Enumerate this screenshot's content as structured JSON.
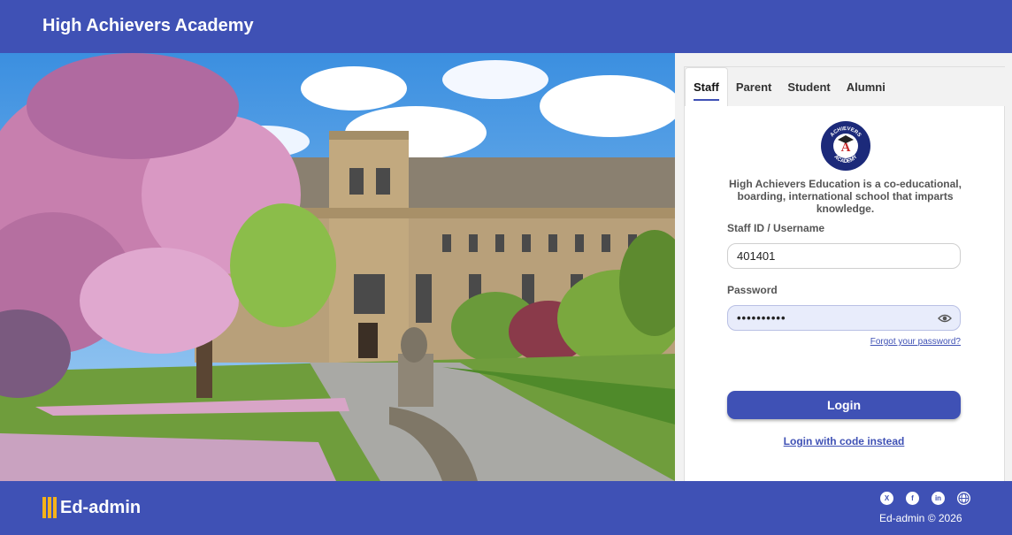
{
  "header": {
    "title": "High Achievers Academy"
  },
  "hero": {
    "image": "campus-photo"
  },
  "tabs": [
    {
      "label": "Staff",
      "active": true
    },
    {
      "label": "Parent",
      "active": false
    },
    {
      "label": "Student",
      "active": false
    },
    {
      "label": "Alumni",
      "active": false
    }
  ],
  "school": {
    "logo": "achievers-academy-logo",
    "logo_text": "ACHIEVERS ACADEMY",
    "description": "High Achievers Education is a co-educational, boarding, international school that imparts knowledge."
  },
  "form": {
    "username_label": "Staff ID / Username",
    "username_value": "401401",
    "password_label": "Password",
    "password_value": "••••••••••",
    "show_password_icon": "eye-icon",
    "forgot_link": "Forgot your password?",
    "login_button": "Login",
    "code_link": "Login with code instead"
  },
  "footer": {
    "brand": "Ed-admin",
    "copyright": "Ed-admin © 2026",
    "social_icons": [
      "x-icon",
      "facebook-icon",
      "linkedin-icon",
      "globe-icon"
    ]
  },
  "colors": {
    "primary": "#3f51b5",
    "accent": "#f5b21a",
    "panel": "#f2f2f2"
  }
}
